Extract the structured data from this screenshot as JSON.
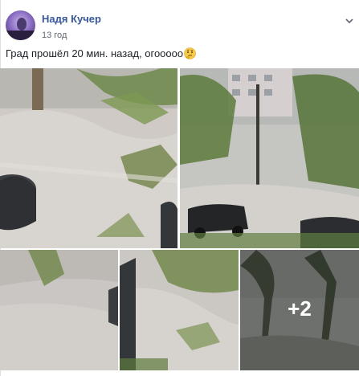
{
  "post": {
    "author_name": "Надя Кучер",
    "timestamp": "13 год",
    "text": "Град прошёл 20 мин. назад, огооооо",
    "emoji": "thinking-face-emoji"
  },
  "photos": {
    "count": 5,
    "more_count_label": "+2"
  },
  "colors": {
    "author_link": "#385898",
    "meta_text": "#616770",
    "body_text": "#1d2129"
  }
}
